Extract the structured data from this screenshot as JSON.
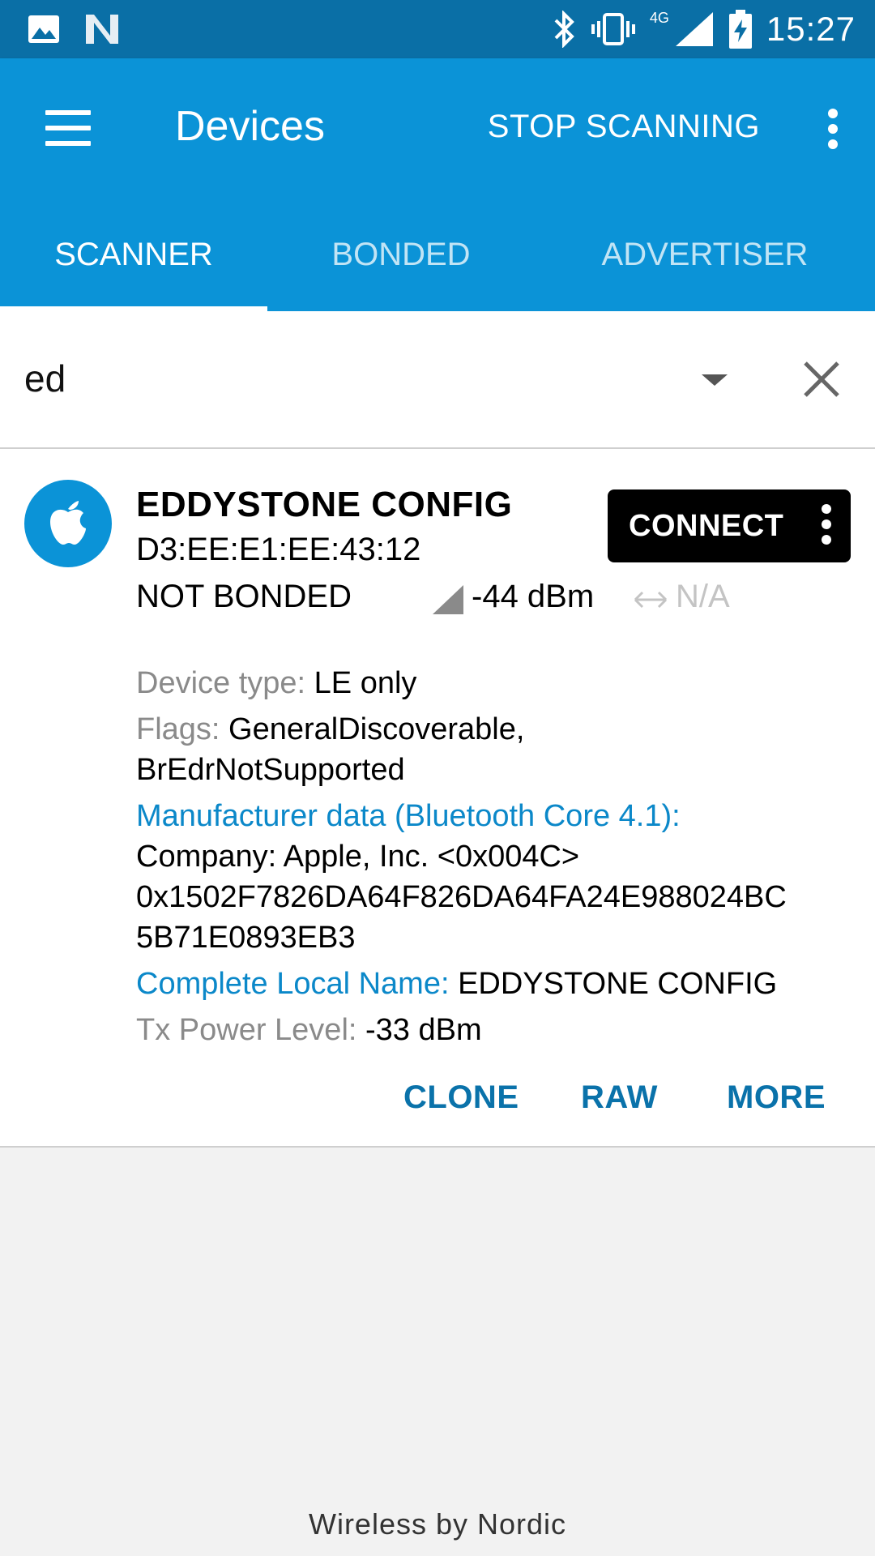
{
  "status_bar": {
    "time": "15:27",
    "network": "4G",
    "left_icons": [
      "image-icon",
      "n-logo-icon"
    ],
    "right_icons": [
      "bluetooth-icon",
      "vibrate-icon",
      "cell-signal-icon",
      "battery-charging-icon"
    ]
  },
  "app_bar": {
    "title": "Devices",
    "stop_label": "STOP SCANNING",
    "colors": {
      "primary": "#0b93d7",
      "status": "#0a6fa6"
    }
  },
  "tabs": [
    {
      "label": "SCANNER",
      "active": true
    },
    {
      "label": "BONDED",
      "active": false
    },
    {
      "label": "ADVERTISER",
      "active": false
    }
  ],
  "filter": {
    "value": "ed"
  },
  "device": {
    "name": "EDDYSTONE CONFIG",
    "address": "D3:EE:E1:EE:43:12",
    "bond_state": "NOT BONDED",
    "rssi": "-44 dBm",
    "interval": "N/A",
    "connect_label": "CONNECT",
    "details": {
      "device_type_label": "Device type: ",
      "device_type_value": "LE only",
      "flags_label": "Flags: ",
      "flags_value_1": "GeneralDiscoverable,",
      "flags_value_2": "BrEdrNotSupported",
      "manufacturer_label": "Manufacturer data (Bluetooth Core 4.1):",
      "manufacturer_company": "Company: Apple, Inc. <0x004C>",
      "manufacturer_data_1": "0x1502F7826DA64F826DA64FA24E988024BC",
      "manufacturer_data_2": "5B71E0893EB3",
      "local_name_label": "Complete Local Name: ",
      "local_name_value": "EDDYSTONE CONFIG",
      "tx_label": "Tx Power Level: ",
      "tx_value": "-33 dBm"
    },
    "actions": {
      "clone": "CLONE",
      "raw": "RAW",
      "more": "MORE"
    }
  },
  "footer": "Wireless by Nordic"
}
